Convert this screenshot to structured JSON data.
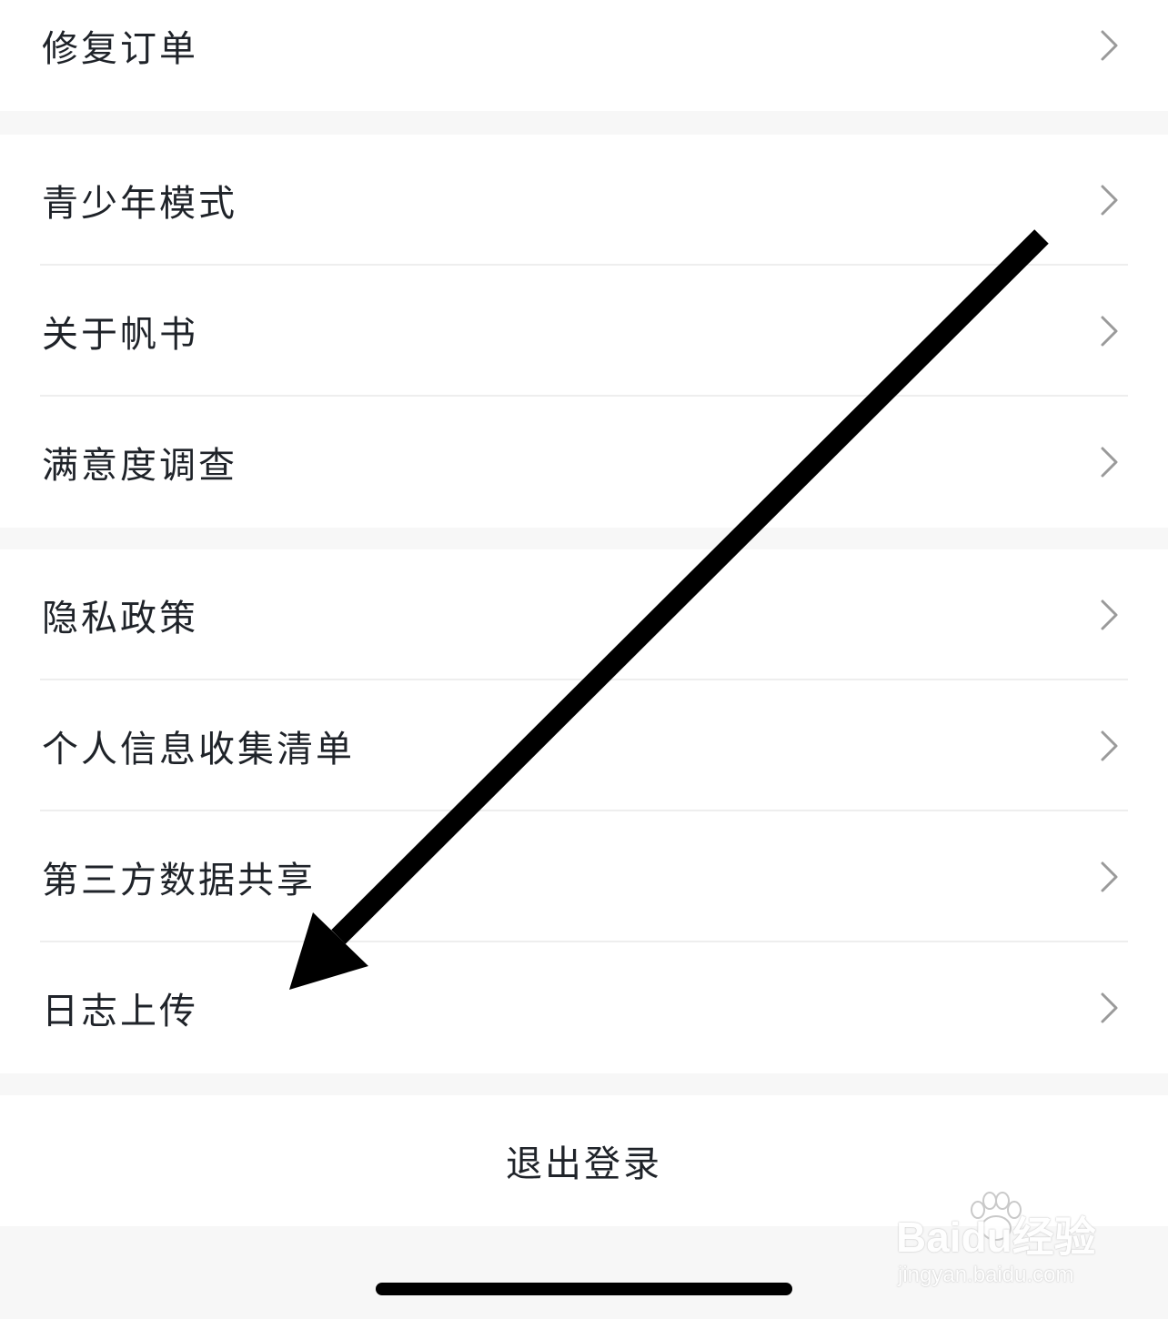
{
  "sections": [
    {
      "items": [
        {
          "label": "修复订单"
        }
      ]
    },
    {
      "items": [
        {
          "label": "青少年模式"
        },
        {
          "label": "关于帆书"
        },
        {
          "label": "满意度调查"
        }
      ]
    },
    {
      "items": [
        {
          "label": "隐私政策"
        },
        {
          "label": "个人信息收集清单"
        },
        {
          "label": "第三方数据共享"
        },
        {
          "label": "日志上传"
        }
      ]
    }
  ],
  "logout": {
    "label": "退出登录"
  },
  "annotation": {
    "type": "arrow",
    "color": "#000000",
    "points_to": "日志上传"
  },
  "watermark": {
    "brand": "Baidu经验",
    "domain": "jingyan.baidu.com"
  },
  "icons": {
    "row_chevron": "chevron-right-icon"
  },
  "colors": {
    "background": "#f7f7f7",
    "card": "#ffffff",
    "text": "#1f2329",
    "chevron": "#9a9a9a"
  }
}
